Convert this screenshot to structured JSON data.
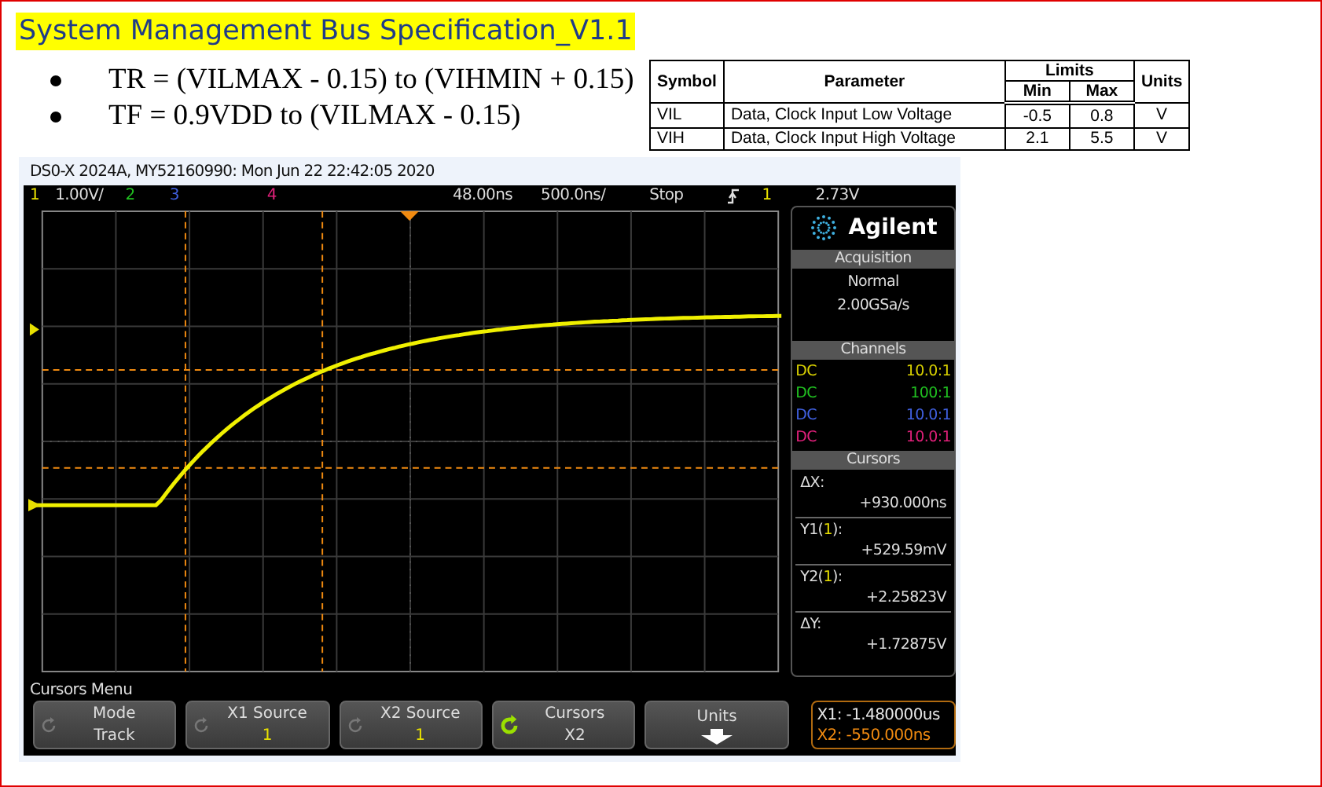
{
  "title": "System Management Bus Specification_V1.1",
  "bullets": [
    "TR = (VILMAX - 0.15) to (VIHMIN + 0.15)",
    "TF = 0.9VDD to (VILMAX - 0.15)"
  ],
  "spec_table": {
    "columns": [
      "Symbol",
      "Parameter",
      "Limits",
      "Units"
    ],
    "subcolumns": [
      "Min",
      "Max"
    ],
    "rows": [
      {
        "symbol": "VIL",
        "parameter": "Data, Clock Input Low Voltage",
        "min": "-0.5",
        "max": "0.8",
        "units": "V"
      },
      {
        "symbol": "VIH",
        "parameter": "Data, Clock Input High Voltage",
        "min": "2.1",
        "max": "5.5",
        "units": "V"
      }
    ]
  },
  "scope": {
    "caption": "DS0-X 2024A, MY52160990: Mon Jun 22 22:42:05 2020",
    "status_bar": {
      "channels": [
        {
          "label": "1",
          "color": "#e8e000",
          "scale": "1.00V/"
        },
        {
          "label": "2",
          "color": "#20c020"
        },
        {
          "label": "3",
          "color": "#4060e0"
        },
        {
          "label": "4",
          "color": "#e0207a"
        }
      ],
      "delay": "48.00ns",
      "timebase": "500.0ns/",
      "run_state": "Stop",
      "trigger_source": "1",
      "trigger_level": "2.73V"
    },
    "brand": "Agilent",
    "acquisition": {
      "header": "Acquisition",
      "mode": "Normal",
      "rate": "2.00GSa/s"
    },
    "channels": {
      "header": "Channels",
      "rows": [
        {
          "coupling": "DC",
          "probe": "10.0:1",
          "color": "#d8d000"
        },
        {
          "coupling": "DC",
          "probe": "100:1",
          "color": "#20c020"
        },
        {
          "coupling": "DC",
          "probe": "10.0:1",
          "color": "#4060e0"
        },
        {
          "coupling": "DC",
          "probe": "10.0:1",
          "color": "#e0207a"
        }
      ]
    },
    "cursors": {
      "header": "Cursors",
      "readings": [
        {
          "label": "ΔX:",
          "value": "+930.000ns"
        },
        {
          "label": "Y1(",
          "channel": "1",
          "label_end": "):",
          "value": "+529.59mV"
        },
        {
          "label": "Y2(",
          "channel": "1",
          "label_end": "):",
          "value": "+2.25823V"
        },
        {
          "label": "ΔY:",
          "value": "+1.72875V"
        }
      ]
    },
    "menu_title": "Cursors Menu",
    "softkeys": [
      {
        "kind": "cycle",
        "label": "Mode",
        "value": "Track"
      },
      {
        "kind": "cycle",
        "label": "X1 Source",
        "value": "1",
        "color": "#e8e000"
      },
      {
        "kind": "cycle",
        "label": "X2 Source",
        "value": "1",
        "color": "#e8e000"
      },
      {
        "kind": "cycle_active",
        "label": "Cursors",
        "value": "X2"
      },
      {
        "kind": "submenu",
        "label": "Units"
      }
    ],
    "cursor_readout": [
      {
        "text": "X1: -1.480000us",
        "color": "#e8e8e8"
      },
      {
        "text": "X2: -550.000ns",
        "color": "#f08a10"
      }
    ]
  }
}
